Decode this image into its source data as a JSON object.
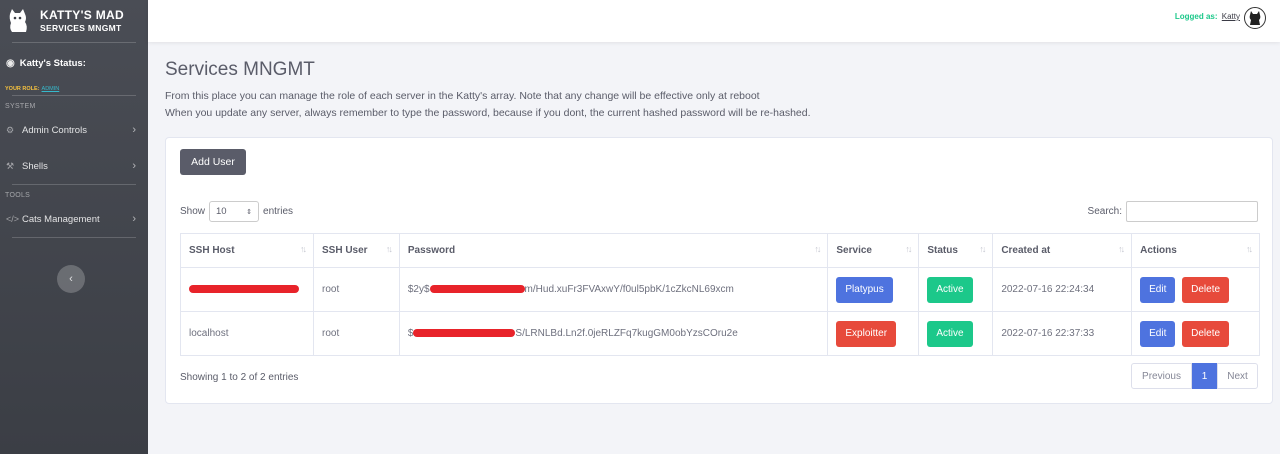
{
  "sidebar": {
    "brand_line1": "KATTY'S MAD",
    "brand_line2": "SERVICES MNGMT",
    "status_label": "Katty's Status:",
    "role_label": "YOUR ROLE:",
    "role_value": "ADMIN",
    "heading_system": "SYSTEM",
    "heading_tools": "TOOLS",
    "items": [
      {
        "label": "Admin Controls",
        "icon": "gear-icon"
      },
      {
        "label": "Shells",
        "icon": "wrench-icon"
      },
      {
        "label": "Cats Management",
        "icon": "code-icon"
      }
    ]
  },
  "topbar": {
    "logged_as": "Logged as:",
    "username": "Katty"
  },
  "main": {
    "title": "Services MNGMT",
    "desc_line1": "From this place you can manage the role of each server in the Katty's array. Note that any change will be effective only at reboot",
    "desc_line2": "When you update any server, always remember to type the password, because if you dont, the current hashed password will be re-hashed.",
    "add_user": "Add User",
    "show": "Show",
    "entries_value": "10",
    "entries": "entries",
    "search_label": "Search:",
    "columns": [
      "SSH Host",
      "SSH User",
      "Password",
      "Service",
      "Status",
      "Created at",
      "Actions"
    ],
    "rows": [
      {
        "host": "",
        "user": "root",
        "pw_prefix": "$2y$",
        "pw_suffix": "m/Hud.xuFr3FVAxwY/f0ul5pbK/1cZkcNL69xcm",
        "service": "Platypus",
        "service_color": "#4e73df",
        "status": "Active",
        "created": "2022-07-16 22:24:34"
      },
      {
        "host": "localhost",
        "user": "root",
        "pw_prefix": "$",
        "pw_suffix": "S/LRNLBd.Ln2f.0jeRLZFq7kugGM0obYzsCOru2e",
        "service": "Exploitter",
        "service_color": "#e74a3b",
        "status": "Active",
        "created": "2022-07-16 22:37:33"
      }
    ],
    "edit": "Edit",
    "delete": "Delete",
    "info": "Showing 1 to 2 of 2 entries",
    "prev": "Previous",
    "page": "1",
    "next": "Next"
  }
}
